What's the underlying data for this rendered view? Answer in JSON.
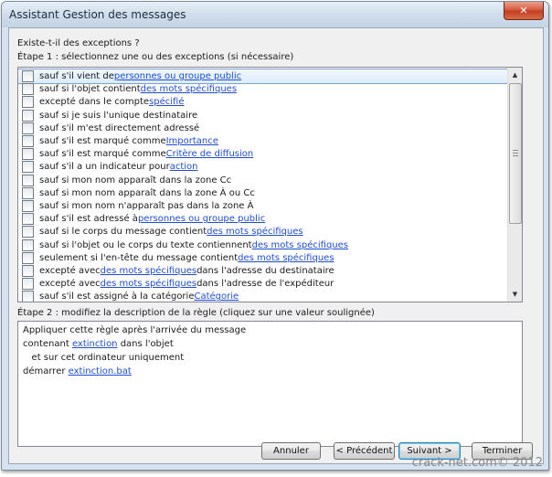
{
  "window": {
    "title": "Assistant Gestion des messages",
    "close_glyph": "✕"
  },
  "question": "Existe-t-il des exceptions ?",
  "step1_label": "Étape 1 : sélectionnez une ou des exceptions (si nécessaire)",
  "exceptions": [
    {
      "pre": "sauf s'il vient de ",
      "link": "personnes ou groupe public",
      "post": "",
      "checked": false,
      "selected": true
    },
    {
      "pre": "sauf si l'objet contient ",
      "link": "des mots spécifiques",
      "post": "",
      "checked": false
    },
    {
      "pre": "excepté dans le compte ",
      "link": "spécifié",
      "post": "",
      "checked": false
    },
    {
      "pre": "sauf si je suis l'unique destinataire",
      "link": "",
      "post": "",
      "checked": false
    },
    {
      "pre": "sauf s'il m'est directement adressé",
      "link": "",
      "post": "",
      "checked": false
    },
    {
      "pre": "sauf s'il est marqué comme ",
      "link": "Importance",
      "post": "",
      "checked": false
    },
    {
      "pre": "sauf s'il est marqué comme ",
      "link": "Critère de diffusion",
      "post": "",
      "checked": false
    },
    {
      "pre": "sauf s'il a un indicateur pour ",
      "link": "action",
      "post": "",
      "checked": false
    },
    {
      "pre": "sauf si mon nom apparaît dans la zone Cc",
      "link": "",
      "post": "",
      "checked": false
    },
    {
      "pre": "sauf si mon nom apparaît dans la zone À ou Cc",
      "link": "",
      "post": "",
      "checked": false
    },
    {
      "pre": "sauf si mon nom n'apparaît pas dans la zone À",
      "link": "",
      "post": "",
      "checked": false
    },
    {
      "pre": "sauf s'il est adressé à ",
      "link": "personnes ou groupe public",
      "post": "",
      "checked": false
    },
    {
      "pre": "sauf si le corps du message contient ",
      "link": "des mots spécifiques",
      "post": "",
      "checked": false
    },
    {
      "pre": "sauf si l'objet ou le corps du texte contiennent ",
      "link": "des mots spécifiques",
      "post": "",
      "checked": false
    },
    {
      "pre": "seulement si l'en-tête du message contient ",
      "link": "des mots spécifiques",
      "post": "",
      "checked": false
    },
    {
      "pre": "excepté avec ",
      "link": "des mots spécifiques",
      "post": " dans l'adresse du destinataire",
      "checked": false
    },
    {
      "pre": "excepté avec ",
      "link": "des mots spécifiques",
      "post": " dans l'adresse de l'expéditeur",
      "checked": false
    },
    {
      "pre": "sauf s'il est assigné à la catégorie ",
      "link": "Catégorie",
      "post": "",
      "checked": false
    }
  ],
  "scrollbar": {
    "up_glyph": "▲",
    "down_glyph": "▼"
  },
  "step2_label": "Étape 2 : modifiez la description de la règle (cliquez sur une valeur soulignée)",
  "description": [
    {
      "pre": "Appliquer cette règle après l'arrivée du message",
      "link": "",
      "post": ""
    },
    {
      "pre": "contenant ",
      "link": "extinction",
      "post": " dans l'objet"
    },
    {
      "pre": "   et sur cet ordinateur uniquement",
      "link": "",
      "post": ""
    },
    {
      "pre": "démarrer ",
      "link": "extinction.bat",
      "post": ""
    }
  ],
  "buttons": {
    "cancel": "Annuler",
    "previous": "< Précédent",
    "next": "Suivant >",
    "finish": "Terminer"
  },
  "watermark": "crack-net.com© 2012"
}
